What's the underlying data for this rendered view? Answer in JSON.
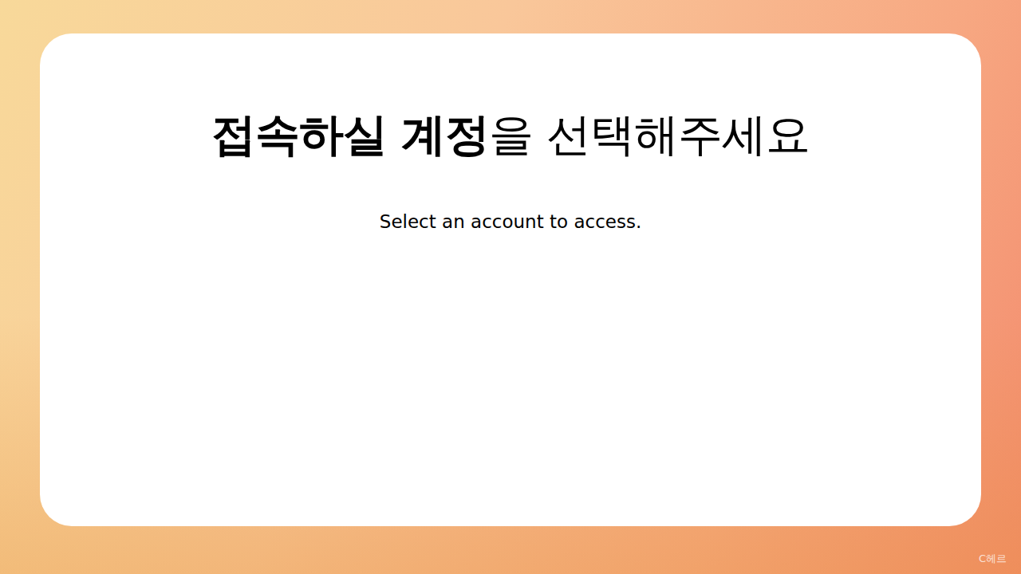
{
  "screen": {
    "title_bold": "접속하실 계정",
    "title_regular": "을 선택해주세요",
    "subtitle": "Select an account to access.",
    "watermark": "C헤르"
  }
}
